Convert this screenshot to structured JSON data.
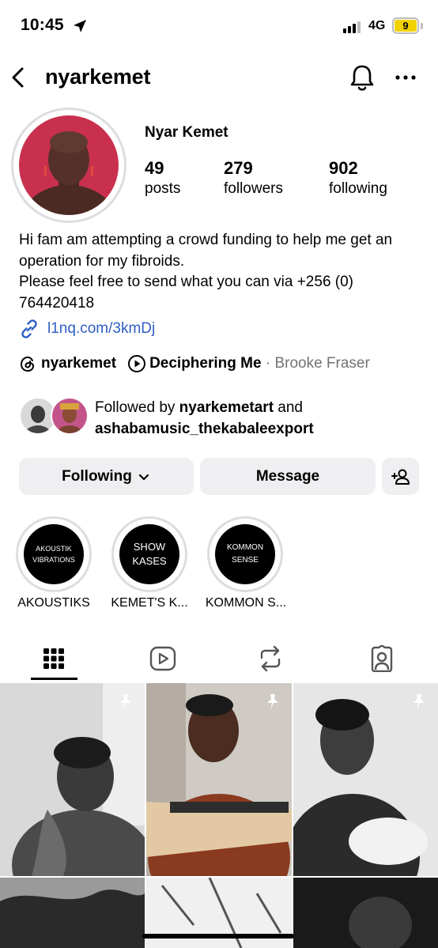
{
  "status_bar": {
    "time": "10:45",
    "network": "4G",
    "battery": "9"
  },
  "header": {
    "username": "nyarkemet"
  },
  "profile": {
    "display_name": "Nyar Kemet",
    "stats": [
      {
        "value": "49",
        "label": "posts"
      },
      {
        "value": "279",
        "label": "followers"
      },
      {
        "value": "902",
        "label": "following"
      }
    ],
    "bio": [
      "Hi fam am attempting a crowd funding to help me get an operation for my fibroids.",
      "Please feel free to send what you can via +256 (0) 764420418"
    ],
    "link": "l1nq.com/3kmDj",
    "threads_handle": "nyarkemet",
    "music_title": "Deciphering Me",
    "music_separator": " · ",
    "music_artist": "Brooke Fraser",
    "followed_by": {
      "prefix": "Followed by ",
      "user1": "nyarkemetart",
      "joiner": " and",
      "user2": "ashabamusic_thekabaleexport"
    }
  },
  "actions": {
    "following_label": "Following",
    "message_label": "Message"
  },
  "highlights": [
    {
      "cover_line1": "AKOUSTIK",
      "cover_line2": "VIBRATIONS",
      "label": "AKOUSTIKS"
    },
    {
      "cover_line1": "SHOW",
      "cover_line2": "KASES",
      "label": "KEMET'S K..."
    },
    {
      "cover_line1": "KOMMON",
      "cover_line2": "SENSE",
      "label": "KOMMON S..."
    }
  ],
  "tabs": [
    {
      "icon": "grid-icon",
      "active": true
    },
    {
      "icon": "reels-icon",
      "active": false
    },
    {
      "icon": "reposts-icon",
      "active": false
    },
    {
      "icon": "tagged-icon",
      "active": false
    }
  ],
  "colors": {
    "link": "#2f5fc4",
    "button_bg": "#efeff2",
    "battery": "#f2d200",
    "avatar_bg": "#c9304d",
    "muted": "#737373"
  }
}
